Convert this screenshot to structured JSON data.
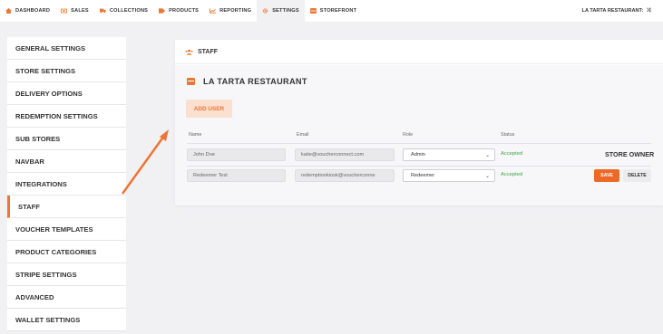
{
  "nav": {
    "items": [
      {
        "label": "DASHBOARD",
        "icon": "home-icon"
      },
      {
        "label": "SALES",
        "icon": "sales-icon"
      },
      {
        "label": "COLLECTIONS",
        "icon": "truck-icon"
      },
      {
        "label": "PRODUCTS",
        "icon": "tag-icon"
      },
      {
        "label": "REPORTING",
        "icon": "chart-icon"
      },
      {
        "label": "SETTINGS",
        "icon": "gear-icon"
      },
      {
        "label": "STOREFRONT",
        "icon": "store-icon"
      }
    ],
    "brand": "LA TARTA RESTAURANT:",
    "brand_icon": "shuffle-icon",
    "accent": "#ec7633"
  },
  "sidebar": {
    "items": [
      {
        "label": "GENERAL SETTINGS"
      },
      {
        "label": "STORE SETTINGS"
      },
      {
        "label": "DELIVERY OPTIONS"
      },
      {
        "label": "REDEMPTION SETTINGS"
      },
      {
        "label": "SUB STORES"
      },
      {
        "label": "NAVBAR"
      },
      {
        "label": "INTEGRATIONS"
      },
      {
        "label": "STAFF"
      },
      {
        "label": "VOUCHER TEMPLATES"
      },
      {
        "label": "PRODUCT CATEGORIES"
      },
      {
        "label": "STRIPE SETTINGS"
      },
      {
        "label": "ADVANCED"
      },
      {
        "label": "WALLET SETTINGS"
      }
    ],
    "active": "STAFF"
  },
  "staff": {
    "header": "STAFF",
    "store_name": "LA TARTA RESTAURANT",
    "add_user_label": "ADD USER",
    "columns": {
      "name": "Name",
      "email": "Email",
      "role": "Role",
      "status": "Status"
    },
    "rows": [
      {
        "name": "John Doe",
        "email": "katie@voucherconnect.com",
        "role": "Admin",
        "status": "Accepted",
        "owner_label": "STORE OWNER"
      },
      {
        "name": "Redeemer Test",
        "email": "redemptionkiosk@voucherconne",
        "role": "Redeemer",
        "status": "Accepted",
        "save_label": "SAVE",
        "delete_label": "DELETE"
      }
    ]
  }
}
